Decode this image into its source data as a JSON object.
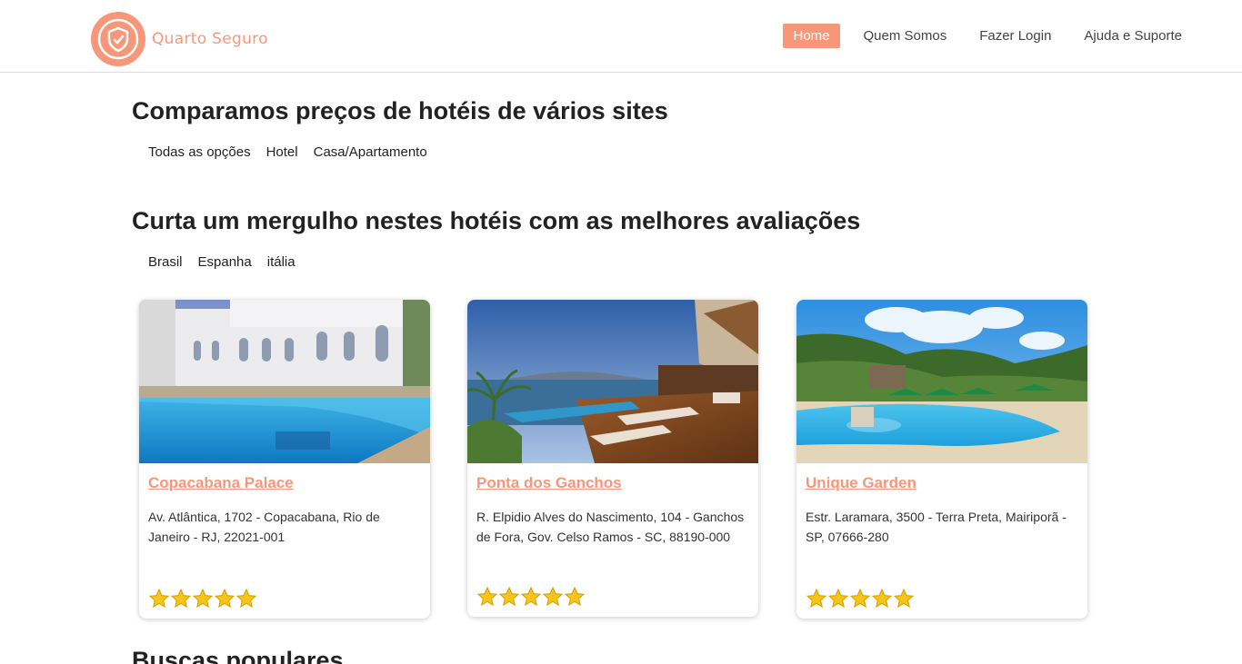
{
  "header": {
    "brand": "Quarto Seguro",
    "nav": [
      {
        "label": "Home",
        "active": true
      },
      {
        "label": "Quem Somos",
        "active": false
      },
      {
        "label": "Fazer Login",
        "active": false
      },
      {
        "label": "Ajuda e Suporte",
        "active": false
      }
    ]
  },
  "compare": {
    "title": "Comparamos preços de hotéis de vários sites",
    "filters": [
      "Todas as opções",
      "Hotel",
      "Casa/Apartamento"
    ]
  },
  "top_rated": {
    "title": "Curta um mergulho nestes hotéis com as melhores avaliações",
    "filters": [
      "Brasil",
      "Espanha",
      "itália"
    ],
    "hotels": [
      {
        "name": "Copacabana Palace",
        "address": "Av. Atlântica, 1702 - Copacabana, Rio de Janeiro - RJ, 22021-001",
        "rating": 5
      },
      {
        "name": "Ponta dos Ganchos",
        "address": "R. Elpidio Alves do Nascimento, 104 - Ganchos de Fora, Gov. Celso Ramos - SC, 88190-000",
        "rating": 5
      },
      {
        "name": "Unique Garden",
        "address": "Estr. Laramara, 3500 - Terra Preta, Mairiporã - SP, 07666-280",
        "rating": 5
      }
    ]
  },
  "popular": {
    "title": "Buscas populares"
  },
  "colors": {
    "accent": "#f7977a",
    "star": "#f5c518"
  }
}
